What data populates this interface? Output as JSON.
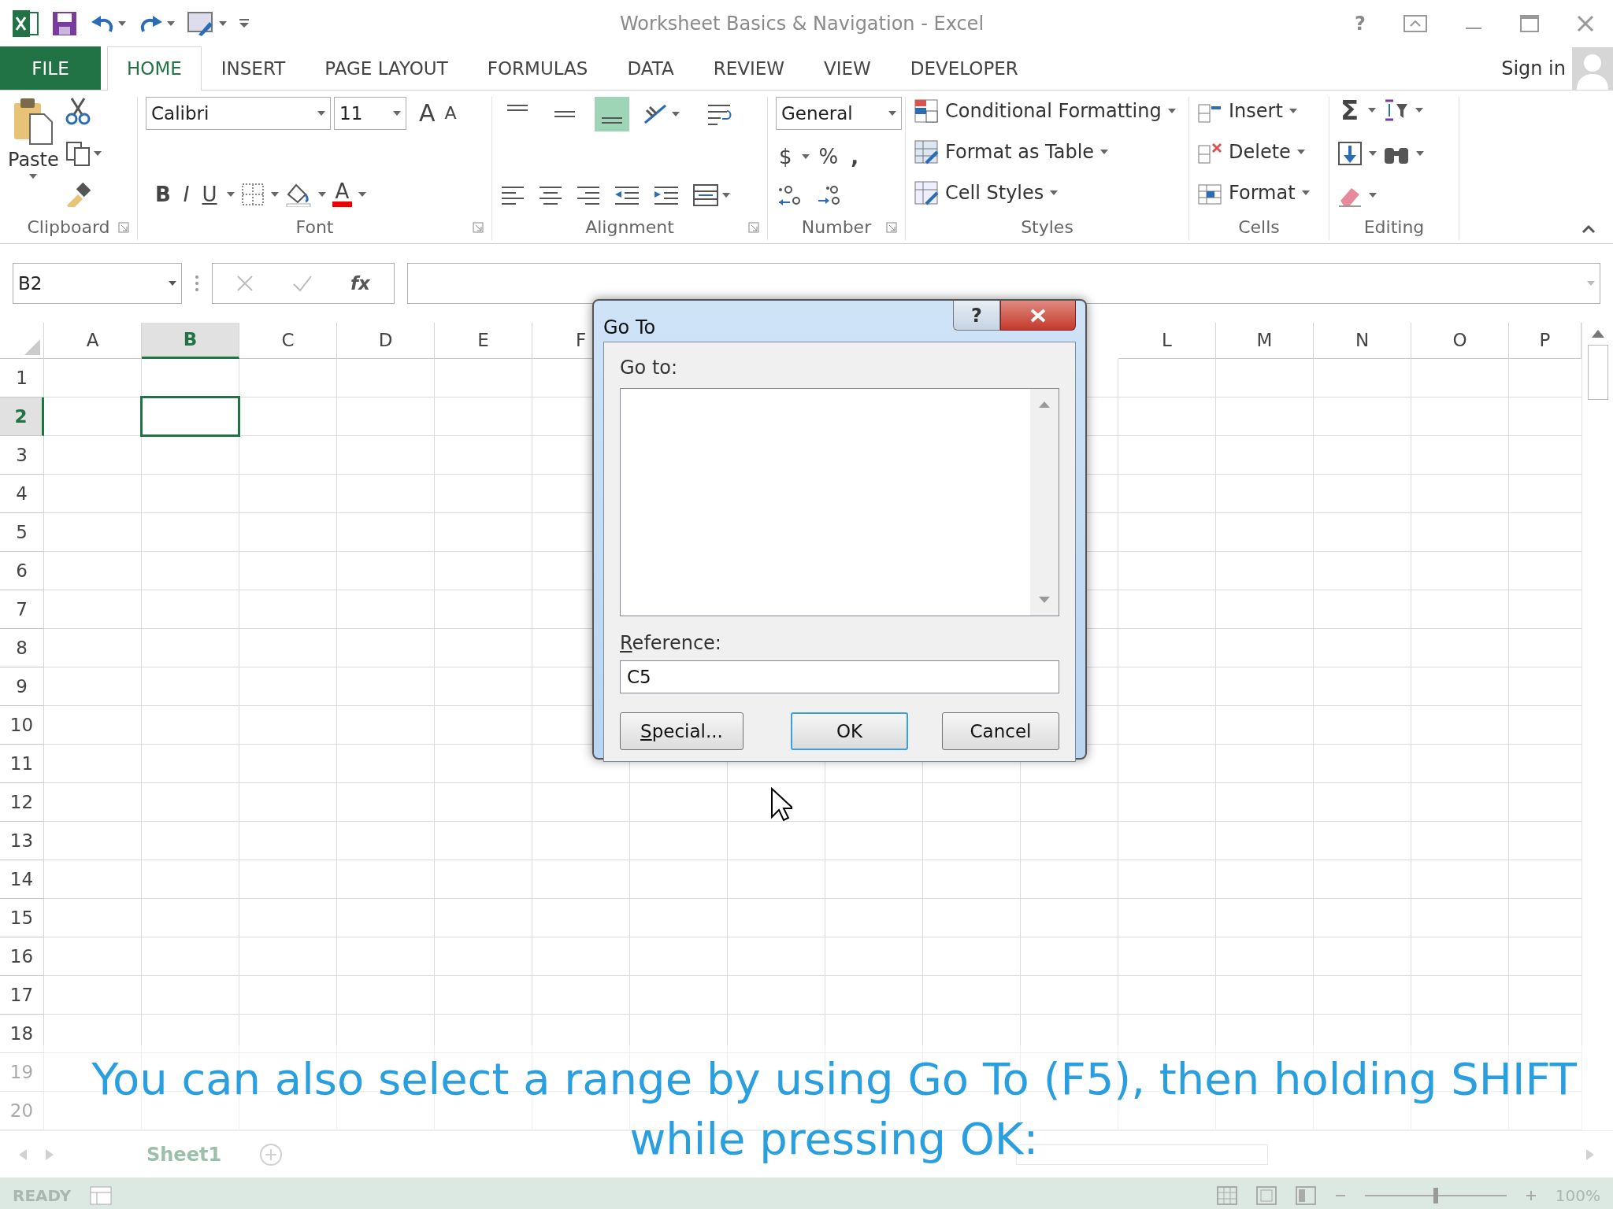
{
  "window": {
    "title": "Worksheet Basics & Navigation - Excel",
    "help": "?"
  },
  "ribbon_tabs": [
    {
      "label": "FILE",
      "kind": "file",
      "selected": false
    },
    {
      "label": "HOME",
      "kind": "tab",
      "selected": true
    },
    {
      "label": "INSERT",
      "kind": "tab",
      "selected": false
    },
    {
      "label": "PAGE LAYOUT",
      "kind": "tab",
      "selected": false
    },
    {
      "label": "FORMULAS",
      "kind": "tab",
      "selected": false
    },
    {
      "label": "DATA",
      "kind": "tab",
      "selected": false
    },
    {
      "label": "REVIEW",
      "kind": "tab",
      "selected": false
    },
    {
      "label": "VIEW",
      "kind": "tab",
      "selected": false
    },
    {
      "label": "DEVELOPER",
      "kind": "tab",
      "selected": false
    }
  ],
  "account": {
    "label": "Sign in"
  },
  "ribbon": {
    "clipboard": {
      "label": "Clipboard",
      "paste": "Paste"
    },
    "font": {
      "label": "Font",
      "font_name": "Calibri",
      "font_size": "11",
      "grow": "A",
      "shrink": "A",
      "bold": "B",
      "italic": "I",
      "underline": "U",
      "font_color": "A"
    },
    "alignment": {
      "label": "Alignment",
      "vertical": [
        {
          "selected": false
        },
        {
          "selected": false
        },
        {
          "selected": true
        }
      ]
    },
    "number": {
      "label": "Number",
      "format": "General",
      "currency": "$",
      "percent": "%",
      "comma": ","
    },
    "styles": {
      "label": "Styles",
      "buttons": [
        "Conditional Formatting",
        "Format as Table",
        "Cell Styles"
      ]
    },
    "cells": {
      "label": "Cells",
      "buttons": [
        "Insert",
        "Delete",
        "Format"
      ]
    },
    "editing": {
      "label": "Editing",
      "sum": "Σ"
    }
  },
  "formula_bar": {
    "name_box": "B2",
    "function": "fx"
  },
  "columns_left": [
    {
      "label": "A",
      "selected": false
    },
    {
      "label": "B",
      "selected": true
    },
    {
      "label": "C",
      "selected": false
    },
    {
      "label": "D",
      "selected": false
    },
    {
      "label": "E",
      "selected": false
    },
    {
      "label": "F",
      "selected": false
    }
  ],
  "columns_right": [
    {
      "label": "L",
      "selected": false
    },
    {
      "label": "M",
      "selected": false
    },
    {
      "label": "N",
      "selected": false
    },
    {
      "label": "O",
      "selected": false
    },
    {
      "label": "P",
      "selected": false
    }
  ],
  "rows": [
    {
      "label": "1",
      "selected": false
    },
    {
      "label": "2",
      "selected": true
    },
    {
      "label": "3",
      "selected": false
    },
    {
      "label": "4",
      "selected": false
    },
    {
      "label": "5",
      "selected": false
    },
    {
      "label": "6",
      "selected": false
    },
    {
      "label": "7",
      "selected": false
    },
    {
      "label": "8",
      "selected": false
    },
    {
      "label": "9",
      "selected": false
    },
    {
      "label": "10",
      "selected": false
    },
    {
      "label": "11",
      "selected": false
    },
    {
      "label": "12",
      "selected": false
    },
    {
      "label": "13",
      "selected": false
    },
    {
      "label": "14",
      "selected": false
    },
    {
      "label": "15",
      "selected": false
    },
    {
      "label": "16",
      "selected": false
    },
    {
      "label": "17",
      "selected": false
    },
    {
      "label": "18",
      "selected": false
    },
    {
      "label": "19",
      "selected": false
    },
    {
      "label": "20",
      "selected": false
    }
  ],
  "sheet_tabs": [
    {
      "label": "Sheet1",
      "selected": true
    }
  ],
  "status_bar": {
    "mode": "READY",
    "zoom": {
      "level": 0.5,
      "reading": "100%"
    }
  },
  "dialog": {
    "title": "Go To",
    "help": "?",
    "goto_label": "Go to:",
    "reference_label": "Reference:",
    "reference_value": "C5",
    "buttons": [
      {
        "label": "Special...",
        "default": false
      },
      {
        "label": "OK",
        "default": true
      },
      {
        "label": "Cancel",
        "default": false
      }
    ]
  },
  "caption": "You can also select a range by using Go To (F5), then holding SHIFT while pressing OK:"
}
